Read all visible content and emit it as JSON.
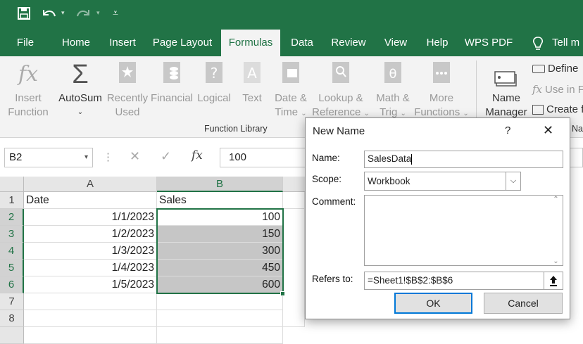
{
  "quick_access": {
    "save_icon": "save-icon",
    "undo_icon": "undo-icon",
    "redo_icon": "redo-icon",
    "customize_icon": "customize-qat-icon"
  },
  "tabs": [
    "File",
    "Home",
    "Insert",
    "Page Layout",
    "Formulas",
    "Data",
    "Review",
    "View",
    "Help",
    "WPS PDF",
    "Tell m"
  ],
  "active_tab": "Formulas",
  "ribbon": {
    "insert_function": [
      "Insert",
      "Function"
    ],
    "autosum": "AutoSum",
    "recently_used": [
      "Recently",
      "Used"
    ],
    "financial": "Financial",
    "logical": "Logical",
    "text": "Text",
    "date_time": [
      "Date &",
      "Time"
    ],
    "lookup": [
      "Lookup &",
      "Reference"
    ],
    "math": [
      "Math &",
      "Trig"
    ],
    "more": [
      "More",
      "Functions"
    ],
    "group_label": "Function Library",
    "name_manager": [
      "Name",
      "Manager"
    ],
    "define": "Define",
    "use_in": "Use in F",
    "create": "Create f",
    "defined_names_group": "Na"
  },
  "formula_bar": {
    "name_box": "B2",
    "fx_label": "fx",
    "content": "100"
  },
  "grid": {
    "columns": [
      "A",
      "B"
    ],
    "rows": [
      "1",
      "2",
      "3",
      "4",
      "5",
      "6",
      "7",
      "8"
    ],
    "a1": "Date",
    "b1": "Sales",
    "dates": [
      "1/1/2023",
      "1/2/2023",
      "1/3/2023",
      "1/4/2023",
      "1/5/2023"
    ],
    "sales": [
      "100",
      "150",
      "300",
      "450",
      "600"
    ]
  },
  "dialog": {
    "title": "New Name",
    "help": "?",
    "name_label": "Name:",
    "name_value": "SalesData",
    "scope_label": "Scope:",
    "scope_value": "Workbook",
    "comment_label": "Comment:",
    "refers_label": "Refers to:",
    "refers_value": "=Sheet1!$B$2:$B$6",
    "ok": "OK",
    "cancel": "Cancel"
  },
  "colors": {
    "accent": "#217346",
    "selection": "#c6c6c6",
    "focus": "#0078d7"
  }
}
